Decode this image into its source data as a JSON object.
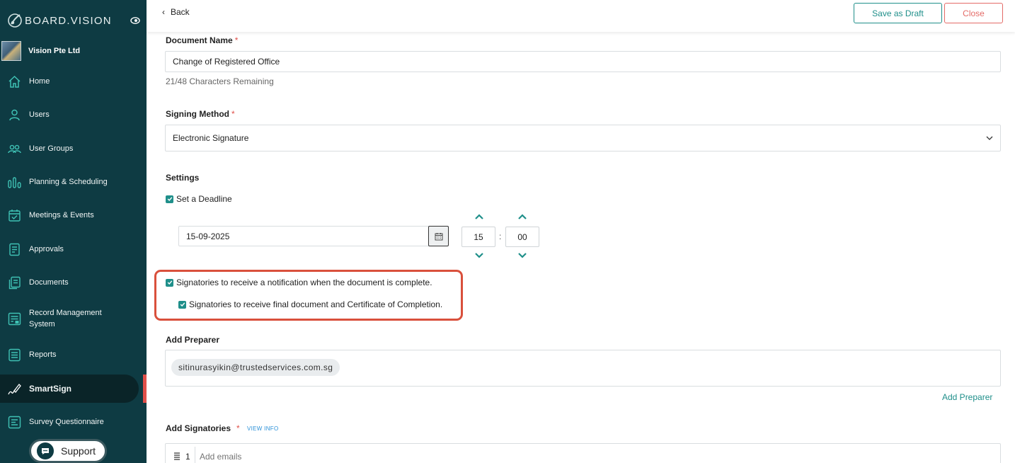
{
  "app": {
    "brand": "BOARD.VISION",
    "org_name": "Vision Pte Ltd"
  },
  "sidebar": {
    "items": [
      {
        "label": "Home",
        "icon": "home-icon"
      },
      {
        "label": "Users",
        "icon": "user-icon"
      },
      {
        "label": "User Groups",
        "icon": "user-group-icon"
      },
      {
        "label": "Planning & Scheduling",
        "icon": "bars-chart-icon"
      },
      {
        "label": "Meetings & Events",
        "icon": "calendar-check-icon"
      },
      {
        "label": "Approvals",
        "icon": "approval-doc-icon"
      },
      {
        "label": "Documents",
        "icon": "documents-icon"
      },
      {
        "label": "Record Management System",
        "icon": "record-icon"
      },
      {
        "label": "Reports",
        "icon": "report-icon"
      },
      {
        "label": "SmartSign",
        "icon": "pen-sign-icon",
        "active": true
      },
      {
        "label": "Survey Questionnaire",
        "icon": "survey-icon"
      }
    ],
    "support_label": "Support"
  },
  "topbar": {
    "back_label": "Back",
    "save_draft_label": "Save as Draft",
    "close_label": "Close"
  },
  "form": {
    "document_name": {
      "label": "Document Name",
      "required_mark": "*",
      "value": "Change of Registered Office",
      "counter": "21/48 Characters Remaining"
    },
    "signing_method": {
      "label": "Signing Method",
      "required_mark": "*",
      "value": "Electronic Signature"
    },
    "settings": {
      "label": "Settings",
      "deadline_label": "Set a Deadline",
      "deadline_checked": true,
      "date": "15-09-2025",
      "hour": "15",
      "minute": "00",
      "time_separator": ":",
      "notify_label": "Signatories to receive a notification when the document is complete.",
      "notify_checked": true,
      "final_doc_label": "Signatories to receive final document and Certificate of Completion.",
      "final_doc_checked": true
    },
    "preparer": {
      "label": "Add Preparer",
      "chip": "sitinurasyikin@trustedservices.com.sg",
      "add_link": "Add Preparer"
    },
    "signatories": {
      "label": "Add Signatories",
      "required_mark": "*",
      "view_info": "VIEW INFO",
      "row_number": "1",
      "placeholder": "Add emails"
    }
  },
  "colors": {
    "sidebar_bg": "#0e3b43",
    "accent": "#1f8f8a",
    "danger": "#e46b67",
    "highlight": "#d9503c"
  }
}
